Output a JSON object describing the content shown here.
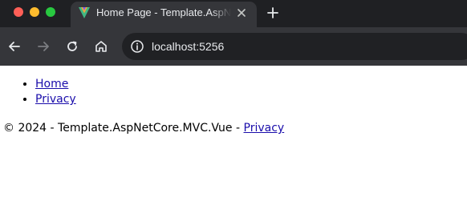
{
  "browser": {
    "tab_title": "Home Page - Template.AspNetCore.MVC.Vue",
    "address": "localhost:5256",
    "colors": {
      "tab_strip": "#1f2023",
      "toolbar": "#35363a",
      "omnibox": "#202124"
    }
  },
  "icons": {
    "favicon": "vue-logo-icon",
    "tab_close": "close-icon",
    "new_tab": "plus-icon",
    "back": "arrow-left-icon",
    "forward": "arrow-right-icon",
    "reload": "reload-icon",
    "home": "home-icon",
    "site_info": "info-icon"
  },
  "page": {
    "nav": [
      {
        "label": "Home"
      },
      {
        "label": "Privacy"
      }
    ],
    "footer": {
      "text": "© 2024 - Template.AspNetCore.MVC.Vue - ",
      "link_label": "Privacy"
    }
  }
}
